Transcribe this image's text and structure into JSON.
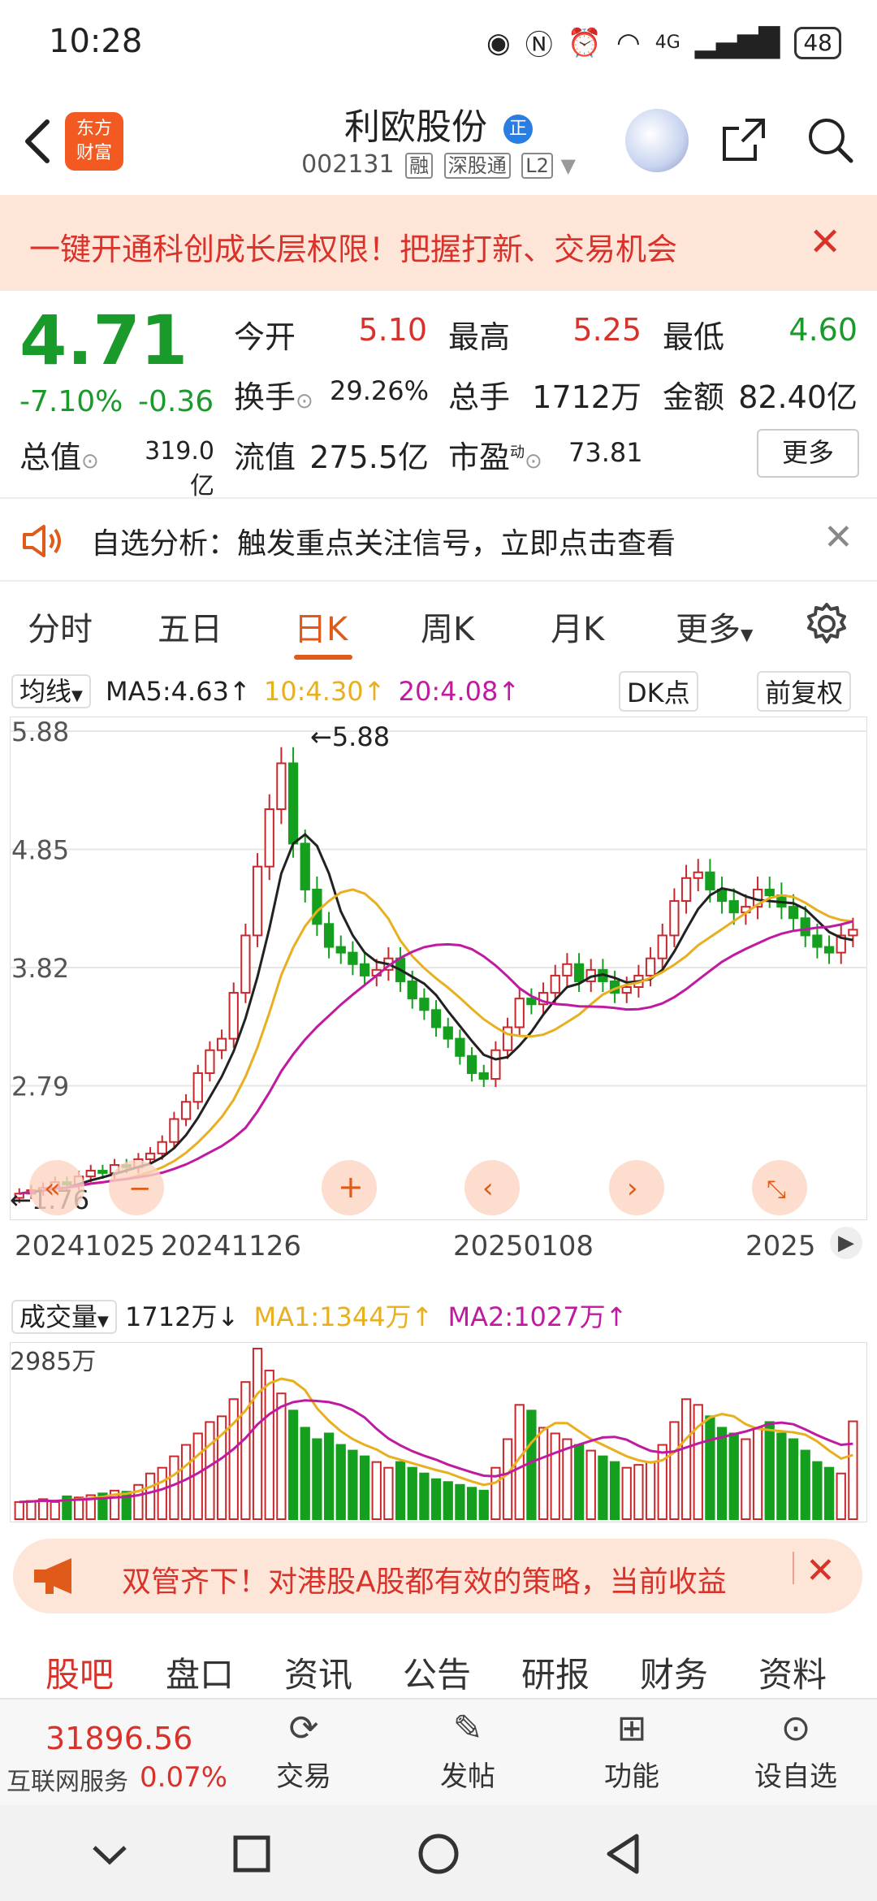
{
  "status_bar": {
    "time": "10:28",
    "network": "4G",
    "battery": "48"
  },
  "header": {
    "title": "利欧股份",
    "title_badge": "正",
    "code": "002131",
    "tags": [
      "融",
      "深股通",
      "L2"
    ],
    "logo_line1": "东方",
    "logo_line2": "财富"
  },
  "banner": {
    "text": "一键开通科创成长层权限！把握打新、交易机会"
  },
  "quote": {
    "price": "4.71",
    "change_pct": "-7.10%",
    "change_amt": "-0.36",
    "open_label": "今开",
    "open": "5.10",
    "high_label": "最高",
    "high": "5.25",
    "low_label": "最低",
    "low": "4.60",
    "turnover_label": "换手",
    "turnover": "29.26%",
    "volume_label": "总手",
    "volume": "1712万",
    "amount_label": "金额",
    "amount": "82.40亿",
    "mktcap_label": "总值",
    "mktcap": "319.0亿",
    "float_label": "流值",
    "float": "275.5亿",
    "pe_label": "市盈",
    "pe_sup": "动",
    "pe": "73.81",
    "more": "更多"
  },
  "notice": {
    "text": "自选分析：触发重点关注信号，立即点击查看"
  },
  "period_tabs": [
    "分时",
    "五日",
    "日K",
    "周K",
    "月K",
    "更多"
  ],
  "ma_legend": {
    "selector": "均线",
    "ma5": "MA5:4.63↑",
    "ma10": "10:4.30↑",
    "ma20": "20:4.08↑",
    "dk": "DK点",
    "adjust": "前复权"
  },
  "chart_data": {
    "type": "candlestick",
    "y_ticks": [
      "5.88",
      "4.85",
      "3.82",
      "2.79"
    ],
    "y_range": [
      1.76,
      5.88
    ],
    "max_label": "←5.88",
    "min_label": "←1.76",
    "x_labels": [
      "20241025",
      "20241126",
      "20250108",
      "2025"
    ],
    "closes": [
      1.85,
      1.88,
      1.9,
      1.95,
      1.93,
      2.0,
      2.05,
      2.03,
      2.1,
      2.08,
      2.15,
      2.2,
      2.3,
      2.5,
      2.65,
      2.9,
      3.1,
      3.2,
      3.6,
      4.1,
      4.7,
      5.2,
      5.6,
      4.9,
      4.5,
      4.2,
      4.0,
      3.95,
      3.85,
      3.75,
      3.8,
      3.9,
      3.7,
      3.55,
      3.45,
      3.3,
      3.2,
      3.05,
      2.9,
      2.85,
      3.1,
      3.3,
      3.55,
      3.5,
      3.6,
      3.75,
      3.85,
      3.7,
      3.8,
      3.7,
      3.6,
      3.65,
      3.75,
      3.9,
      4.1,
      4.4,
      4.6,
      4.65,
      4.5,
      4.4,
      4.3,
      4.35,
      4.5,
      4.45,
      4.35,
      4.25,
      4.1,
      4.0,
      3.95,
      4.1,
      4.15
    ]
  },
  "volume_legend": {
    "selector": "成交量",
    "value": "1712万↓",
    "ma1": "MA1:1344万↑",
    "ma2": "MA2:1027万↑",
    "y_max": "2985万"
  },
  "volume_data": {
    "values": [
      300,
      320,
      350,
      300,
      400,
      380,
      420,
      450,
      500,
      480,
      600,
      800,
      900,
      1100,
      1300,
      1500,
      1700,
      1800,
      2100,
      2400,
      2985,
      2600,
      2200,
      1900,
      1600,
      1400,
      1500,
      1300,
      1200,
      1100,
      1000,
      900,
      1000,
      900,
      800,
      700,
      650,
      600,
      550,
      500,
      900,
      1400,
      2000,
      1900,
      1600,
      1500,
      1400,
      1300,
      1200,
      1100,
      1000,
      900,
      950,
      1000,
      1300,
      1700,
      2100,
      2000,
      1800,
      1600,
      1500,
      1400,
      1600,
      1700,
      1500,
      1400,
      1200,
      1000,
      900,
      800,
      1712
    ]
  },
  "ad": {
    "text": "双管齐下！对港股A股都有效的策略，当前收益"
  },
  "bottom_tabs": [
    "股吧",
    "盘口",
    "资讯",
    "公告",
    "研报",
    "财务",
    "资料"
  ],
  "bottom_bar": {
    "index_value": "31896.56",
    "index_name": "互联网服务",
    "index_pct": "0.07%",
    "trade": "交易",
    "post": "发帖",
    "functions": "功能",
    "watchlist": "设自选"
  }
}
